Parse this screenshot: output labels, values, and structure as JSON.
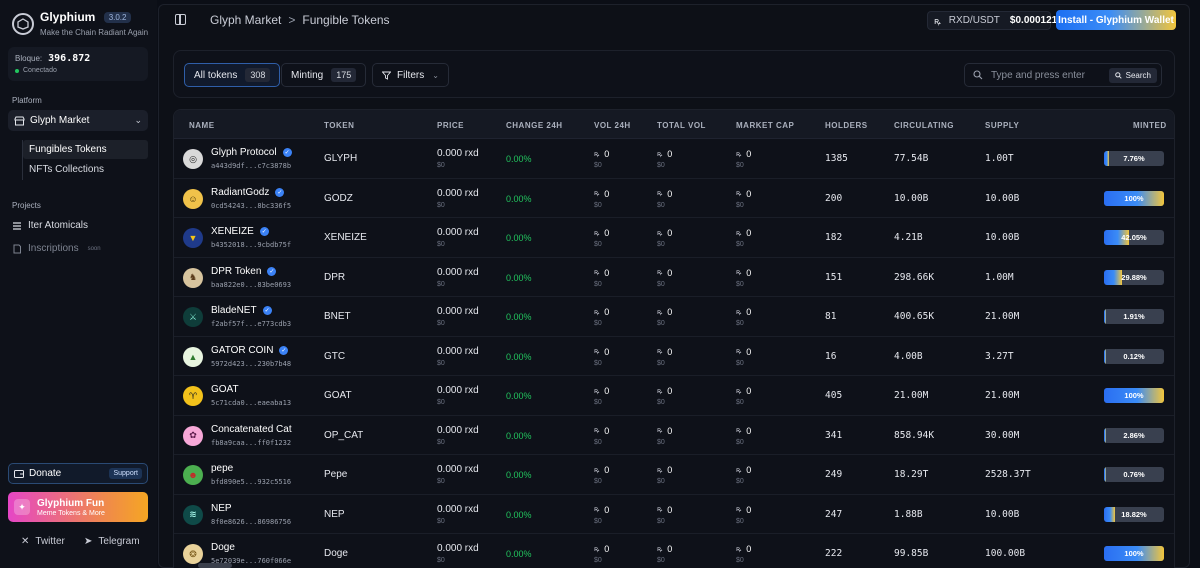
{
  "brand": {
    "name": "Glyphium",
    "version": "3.0.2",
    "tagline": "Make the Chain Radiant Again"
  },
  "block": {
    "label": "Bloque:",
    "value": "396.872",
    "status": "Conectado"
  },
  "sidebar": {
    "platform_label": "Platform",
    "market_select": "Glyph Market",
    "subnav": [
      {
        "label": "Fungibles Tokens",
        "active": true
      },
      {
        "label": "NFTs Collections",
        "active": false
      }
    ],
    "projects_label": "Projects",
    "projects": [
      {
        "label": "Iter Atomicals",
        "icon": "list-icon"
      },
      {
        "label": "Inscriptions",
        "icon": "document-icon",
        "badge": "soon"
      }
    ],
    "donate": {
      "label": "Donate",
      "badge": "Support"
    },
    "fun": {
      "title": "Glyphium Fun",
      "subtitle": "Meme Tokens & More"
    },
    "social": [
      {
        "label": "Twitter",
        "icon": "x-icon"
      },
      {
        "label": "Telegram",
        "icon": "telegram-icon"
      }
    ]
  },
  "header": {
    "breadcrumb": [
      "Glyph Market",
      "Fungible Tokens"
    ],
    "breadcrumb_sep": ">",
    "pair": "RXD/USDT",
    "pair_price": "$0.000121",
    "install_label": "Install - Glyphium Wallet"
  },
  "filters": {
    "tabs": [
      {
        "label": "All tokens",
        "count": "308",
        "active": true
      },
      {
        "label": "Minting",
        "count": "175",
        "active": false
      }
    ],
    "filters_label": "Filters",
    "search_placeholder": "Type and press enter",
    "search_button": "Search"
  },
  "table": {
    "columns": [
      "NAME",
      "TOKEN",
      "PRICE",
      "CHANGE 24H",
      "VOL 24H",
      "TOTAL VOL",
      "MARKET CAP",
      "HOLDERS",
      "CIRCULATING",
      "SUPPLY",
      "MINTED"
    ],
    "rows": [
      {
        "name": "Glyph Protocol",
        "verified": true,
        "id": "a443d9df...c7c3878b",
        "ticker": "GLYPH",
        "price": "0.000 rxd",
        "price_usd": "$0",
        "change": "0.00%",
        "vol24": "0",
        "vol24_usd": "$0",
        "total_vol": "0",
        "total_vol_usd": "$0",
        "mcap": "0",
        "mcap_usd": "$0",
        "holders": "1385",
        "circulating": "77.54B",
        "supply": "1.00T",
        "minted": "7.76%",
        "minted_pct": 7.76,
        "icon_bg": "#d9d9d9",
        "icon_fg": "#222",
        "icon_char": "◎"
      },
      {
        "name": "RadiantGodz",
        "verified": true,
        "id": "0cd54243...8bc336f5",
        "ticker": "GODZ",
        "price": "0.000 rxd",
        "price_usd": "$0",
        "change": "0.00%",
        "vol24": "0",
        "vol24_usd": "$0",
        "total_vol": "0",
        "total_vol_usd": "$0",
        "mcap": "0",
        "mcap_usd": "$0",
        "holders": "200",
        "circulating": "10.00B",
        "supply": "10.00B",
        "minted": "100%",
        "minted_pct": 100,
        "icon_bg": "#f0c24a",
        "icon_fg": "#3a2a00",
        "icon_char": "☺"
      },
      {
        "name": "XENEIZE",
        "verified": true,
        "id": "b4352018...9cbdb75f",
        "ticker": "XENEIZE",
        "price": "0.000 rxd",
        "price_usd": "$0",
        "change": "0.00%",
        "vol24": "0",
        "vol24_usd": "$0",
        "total_vol": "0",
        "total_vol_usd": "$0",
        "mcap": "0",
        "mcap_usd": "$0",
        "holders": "182",
        "circulating": "4.21B",
        "supply": "10.00B",
        "minted": "42.05%",
        "minted_pct": 42.05,
        "icon_bg": "#1f3a8a",
        "icon_fg": "#f5c518",
        "icon_char": "▼"
      },
      {
        "name": "DPR Token",
        "verified": true,
        "id": "baa822e0...83be0693",
        "ticker": "DPR",
        "price": "0.000 rxd",
        "price_usd": "$0",
        "change": "0.00%",
        "vol24": "0",
        "vol24_usd": "$0",
        "total_vol": "0",
        "total_vol_usd": "$0",
        "mcap": "0",
        "mcap_usd": "$0",
        "holders": "151",
        "circulating": "298.66K",
        "supply": "1.00M",
        "minted": "29.88%",
        "minted_pct": 29.88,
        "icon_bg": "#d7c49e",
        "icon_fg": "#5a3a1a",
        "icon_char": "♞"
      },
      {
        "name": "BladeNET",
        "verified": true,
        "id": "f2abf57f...e773cdb3",
        "ticker": "BNET",
        "price": "0.000 rxd",
        "price_usd": "$0",
        "change": "0.00%",
        "vol24": "0",
        "vol24_usd": "$0",
        "total_vol": "0",
        "total_vol_usd": "$0",
        "mcap": "0",
        "mcap_usd": "$0",
        "holders": "81",
        "circulating": "400.65K",
        "supply": "21.00M",
        "minted": "1.91%",
        "minted_pct": 1.91,
        "icon_bg": "#0f3d3a",
        "icon_fg": "#7be0c9",
        "icon_char": "⚔"
      },
      {
        "name": "GATOR COIN",
        "verified": true,
        "id": "5972d423...230b7b48",
        "ticker": "GTC",
        "price": "0.000 rxd",
        "price_usd": "$0",
        "change": "0.00%",
        "vol24": "0",
        "vol24_usd": "$0",
        "total_vol": "0",
        "total_vol_usd": "$0",
        "mcap": "0",
        "mcap_usd": "$0",
        "holders": "16",
        "circulating": "4.00B",
        "supply": "3.27T",
        "minted": "0.12%",
        "minted_pct": 0.12,
        "icon_bg": "#e8f5e0",
        "icon_fg": "#2f7a2f",
        "icon_char": "▲"
      },
      {
        "name": "GOAT",
        "verified": false,
        "id": "5c71cda0...eaeaba13",
        "ticker": "GOAT",
        "price": "0.000 rxd",
        "price_usd": "$0",
        "change": "0.00%",
        "vol24": "0",
        "vol24_usd": "$0",
        "total_vol": "0",
        "total_vol_usd": "$0",
        "mcap": "0",
        "mcap_usd": "$0",
        "holders": "405",
        "circulating": "21.00M",
        "supply": "21.00M",
        "minted": "100%",
        "minted_pct": 100,
        "icon_bg": "#f3c21b",
        "icon_fg": "#222",
        "icon_char": "♈"
      },
      {
        "name": "Concatenated Cat",
        "verified": false,
        "id": "fb8a9caa...ff0f1232",
        "ticker": "OP_CAT",
        "price": "0.000 rxd",
        "price_usd": "$0",
        "change": "0.00%",
        "vol24": "0",
        "vol24_usd": "$0",
        "total_vol": "0",
        "total_vol_usd": "$0",
        "mcap": "0",
        "mcap_usd": "$0",
        "holders": "341",
        "circulating": "858.94K",
        "supply": "30.00M",
        "minted": "2.86%",
        "minted_pct": 2.86,
        "icon_bg": "#f7a8d8",
        "icon_fg": "#5a1a4a",
        "icon_char": "✿"
      },
      {
        "name": "pepe",
        "verified": false,
        "id": "bfd890e5...932c5516",
        "ticker": "Pepe",
        "price": "0.000 rxd",
        "price_usd": "$0",
        "change": "0.00%",
        "vol24": "0",
        "vol24_usd": "$0",
        "total_vol": "0",
        "total_vol_usd": "$0",
        "mcap": "0",
        "mcap_usd": "$0",
        "holders": "249",
        "circulating": "18.29T",
        "supply": "2528.37T",
        "minted": "0.76%",
        "minted_pct": 0.76,
        "icon_bg": "#4caf50",
        "icon_fg": "#c62828",
        "icon_char": "☻"
      },
      {
        "name": "NEP",
        "verified": false,
        "id": "8f0e8626...86986756",
        "ticker": "NEP",
        "price": "0.000 rxd",
        "price_usd": "$0",
        "change": "0.00%",
        "vol24": "0",
        "vol24_usd": "$0",
        "total_vol": "0",
        "total_vol_usd": "$0",
        "mcap": "0",
        "mcap_usd": "$0",
        "holders": "247",
        "circulating": "1.88B",
        "supply": "10.00B",
        "minted": "18.82%",
        "minted_pct": 18.82,
        "icon_bg": "#0f4a48",
        "icon_fg": "#9ff0e4",
        "icon_char": "≋"
      },
      {
        "name": "Doge",
        "verified": false,
        "id": "5e72039e...760f066e",
        "ticker": "Doge",
        "price": "0.000 rxd",
        "price_usd": "$0",
        "change": "0.00%",
        "vol24": "0",
        "vol24_usd": "$0",
        "total_vol": "0",
        "total_vol_usd": "$0",
        "mcap": "0",
        "mcap_usd": "$0",
        "holders": "222",
        "circulating": "99.85B",
        "supply": "100.00B",
        "minted": "100%",
        "minted_pct": 100,
        "icon_bg": "#e9d29a",
        "icon_fg": "#7a5a1a",
        "icon_char": "❂"
      }
    ]
  },
  "rxd_symbol": "ꝶ"
}
